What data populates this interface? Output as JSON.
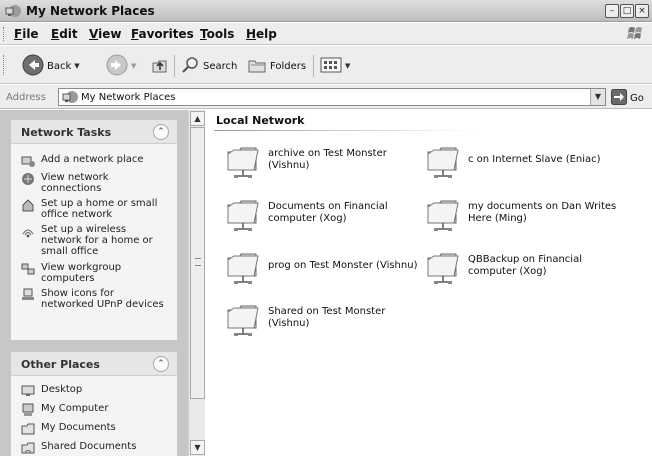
{
  "window": {
    "title": "My Network Places"
  },
  "menu": [
    "File",
    "Edit",
    "View",
    "Favorites",
    "Tools",
    "Help"
  ],
  "toolbar": {
    "back_label": "Back",
    "search_label": "Search",
    "folders_label": "Folders"
  },
  "address": {
    "label": "Address",
    "value": "My Network Places",
    "go_label": "Go"
  },
  "network_tasks": {
    "title": "Network Tasks",
    "items": [
      {
        "label": "Add a network place",
        "icon": "add-network-place-icon"
      },
      {
        "label": "View network connections",
        "icon": "network-connections-icon"
      },
      {
        "label": "Set up a home or small office network",
        "icon": "home-network-icon"
      },
      {
        "label": "Set up a wireless network for a home or small office",
        "icon": "wireless-network-icon"
      },
      {
        "label": "View workgroup computers",
        "icon": "workgroup-icon"
      },
      {
        "label": "Show icons for networked UPnP devices",
        "icon": "upnp-icon"
      }
    ]
  },
  "other_places": {
    "title": "Other Places",
    "items": [
      {
        "label": "Desktop",
        "icon": "desktop-icon"
      },
      {
        "label": "My Computer",
        "icon": "my-computer-icon"
      },
      {
        "label": "My Documents",
        "icon": "my-documents-icon"
      },
      {
        "label": "Shared Documents",
        "icon": "shared-documents-icon"
      }
    ]
  },
  "content": {
    "group_title": "Local Network",
    "shares": [
      "archive on Test Monster (Vishnu)",
      "c on Internet Slave (Eniac)",
      "Documents on Financial computer (Xog)",
      "my documents on Dan Writes Here (Ming)",
      "prog on Test Monster (Vishnu)",
      "QBBackup on Financial computer (Xog)",
      "Shared on Test Monster (Vishnu)"
    ]
  }
}
